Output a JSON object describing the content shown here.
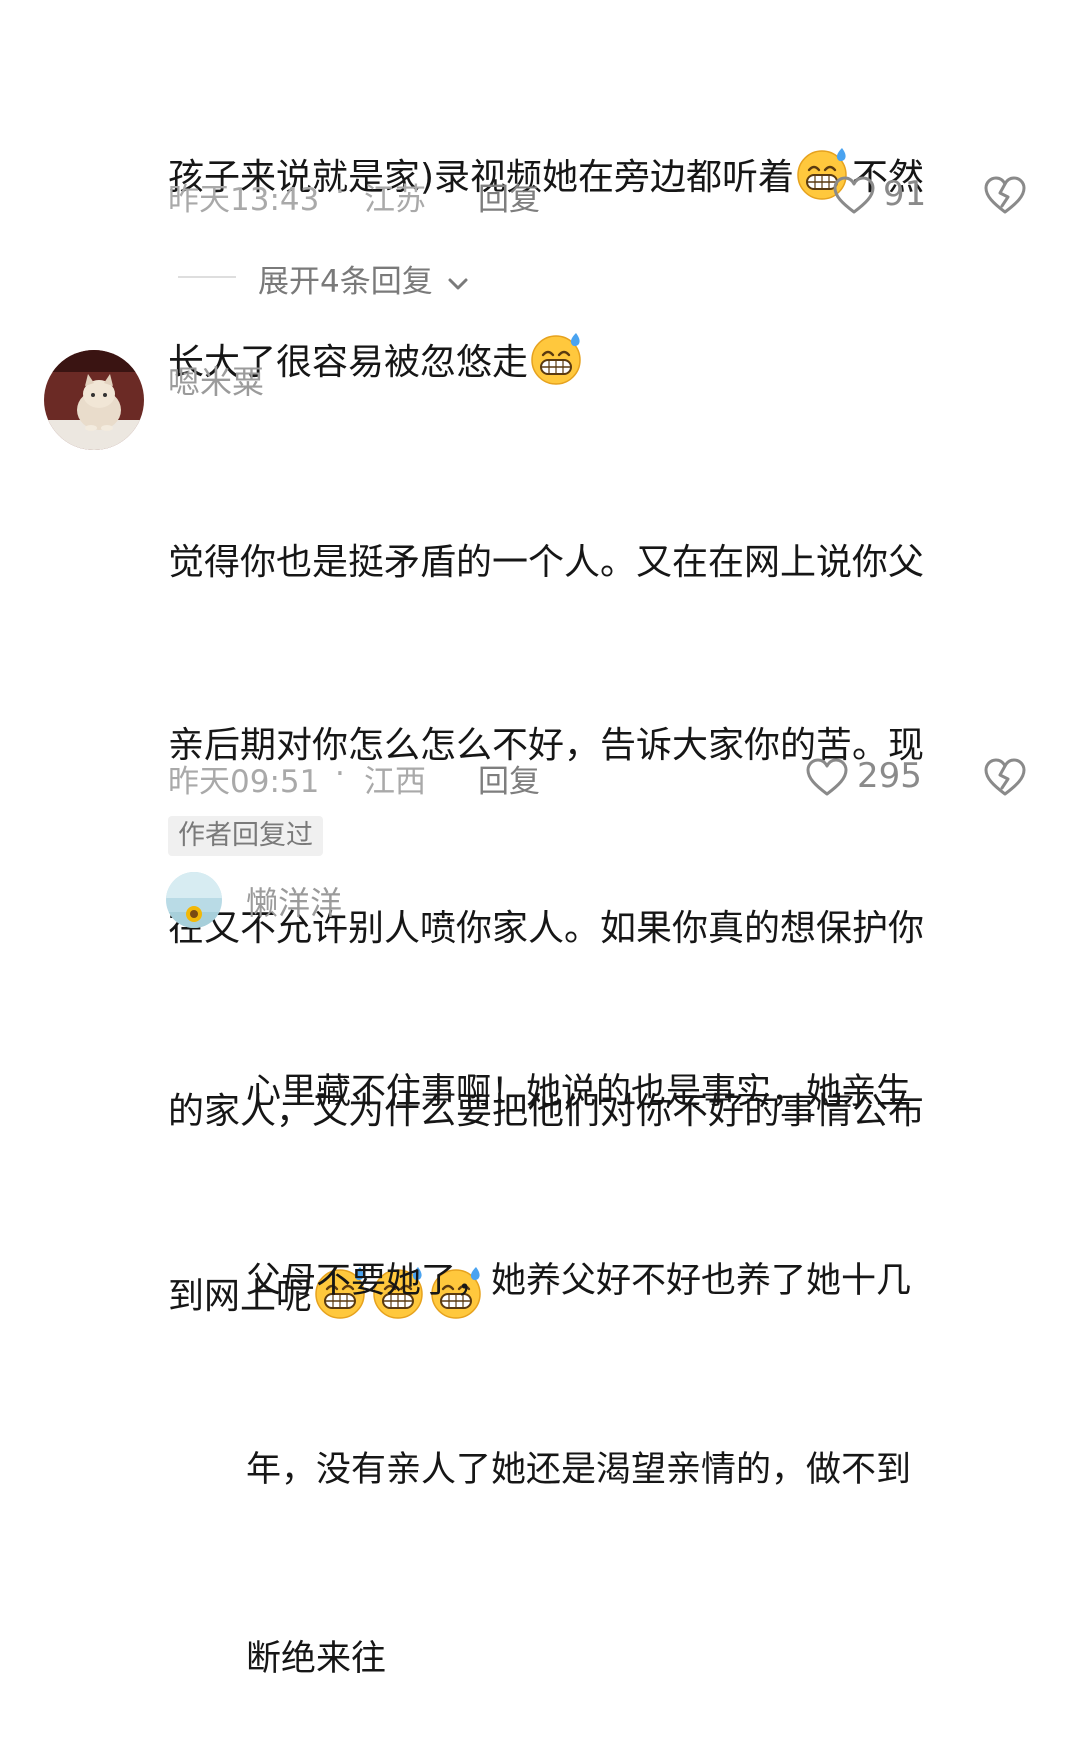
{
  "comment1": {
    "line1": "孩子来说就是家)录视频她在旁边都听着",
    "line1_after": "不然",
    "line2": "长大了很容易被忽悠走",
    "time": "昨天13:43",
    "separator": "·",
    "location": "江苏",
    "reply_label": "回复",
    "likes": "91",
    "expand_label": "展开4条回复"
  },
  "comment2": {
    "username": "嗯米粟",
    "lines": [
      "觉得你也是挺矛盾的一个人。又在在网上说你父",
      "亲后期对你怎么怎么不好，告诉大家你的苦。现",
      "在又不允许别人喷你家人。如果你真的想保护你",
      "的家人，又为什么要把他们对你不好的事情公布",
      "到网上呢"
    ],
    "time": "昨天09:51",
    "separator": "·",
    "location": "江西",
    "reply_label": "回复",
    "likes": "295",
    "author_badge": "作者回复过"
  },
  "reply1": {
    "username": "懒洋洋",
    "lines": [
      "心里藏不住事啊！她说的也是事实，她亲生",
      "父母不要她了，她养父好不好也养了她十几",
      "年，没有亲人了她还是渴望亲情的，做不到",
      "断绝来往"
    ]
  },
  "icons": {
    "emoji": "grinning-sweat-emoji",
    "like": "heart-outline-icon",
    "dislike": "broken-heart-icon",
    "expand": "chevron-down-icon"
  },
  "colors": {
    "text": "#161616",
    "meta": "#a9a9a9",
    "icon": "#8a8a8a",
    "emoji_face": "#ffc83d",
    "emoji_sweat": "#4aa3f0"
  }
}
